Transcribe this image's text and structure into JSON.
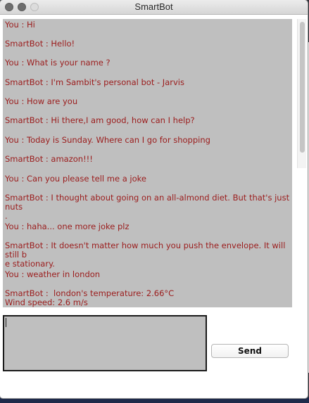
{
  "window": {
    "title": "SmartBot"
  },
  "chat": {
    "messages": [
      "You : Hi",
      "SmartBot : Hello!",
      "You : What is your name ?",
      "SmartBot : I'm Sambit's personal bot - Jarvis",
      "You : How are you",
      "SmartBot : Hi there,I am good, how can I help?",
      "You : Today is Sunday. Where can I go for shopping",
      "SmartBot : amazon!!!",
      "You : Can you please tell me a joke",
      "SmartBot : I thought about going on an all-almond diet. But that's just nuts\n.",
      "You : haha... one more joke plz",
      "SmartBot : It doesn't matter how much you push the envelope. It will still b\ne stationary.",
      "You : weather in london",
      "SmartBot :  london's temperature: 2.66°C\nWind speed: 2.6 m/s"
    ]
  },
  "input": {
    "value": ""
  },
  "send_button": {
    "label": "Send"
  }
}
